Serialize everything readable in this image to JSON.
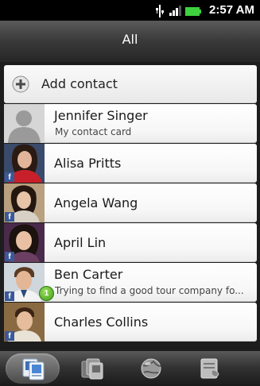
{
  "status_bar": {
    "time": "2:57 AM",
    "icons": [
      "usb-icon",
      "signal-icon",
      "battery-icon"
    ]
  },
  "header": {
    "title": "All"
  },
  "add_contact": {
    "label": "Add contact",
    "icon": "plus-icon"
  },
  "contacts": [
    {
      "name": "Jennifer Singer",
      "subtitle": "My contact card",
      "badge": "",
      "source": ""
    },
    {
      "name": "Alisa Pritts",
      "subtitle": "",
      "badge": "",
      "source": "f"
    },
    {
      "name": "Angela Wang",
      "subtitle": "",
      "badge": "",
      "source": "f"
    },
    {
      "name": "April  Lin",
      "subtitle": "",
      "badge": "",
      "source": "f"
    },
    {
      "name": "Ben  Carter",
      "subtitle": "Trying to find a good tour company fo...",
      "badge": "1",
      "source": "f"
    },
    {
      "name": "Charles  Collins",
      "subtitle": "",
      "badge": "",
      "source": "f"
    }
  ],
  "tabs": [
    {
      "icon": "people-icon",
      "active": true
    },
    {
      "icon": "groups-icon",
      "active": false
    },
    {
      "icon": "online-directory-icon",
      "active": false
    },
    {
      "icon": "call-history-icon",
      "active": false
    }
  ],
  "colors": {
    "facebook": "#3b5998",
    "badge_green": "#5cb82a",
    "battery_green": "#3fd13f"
  }
}
